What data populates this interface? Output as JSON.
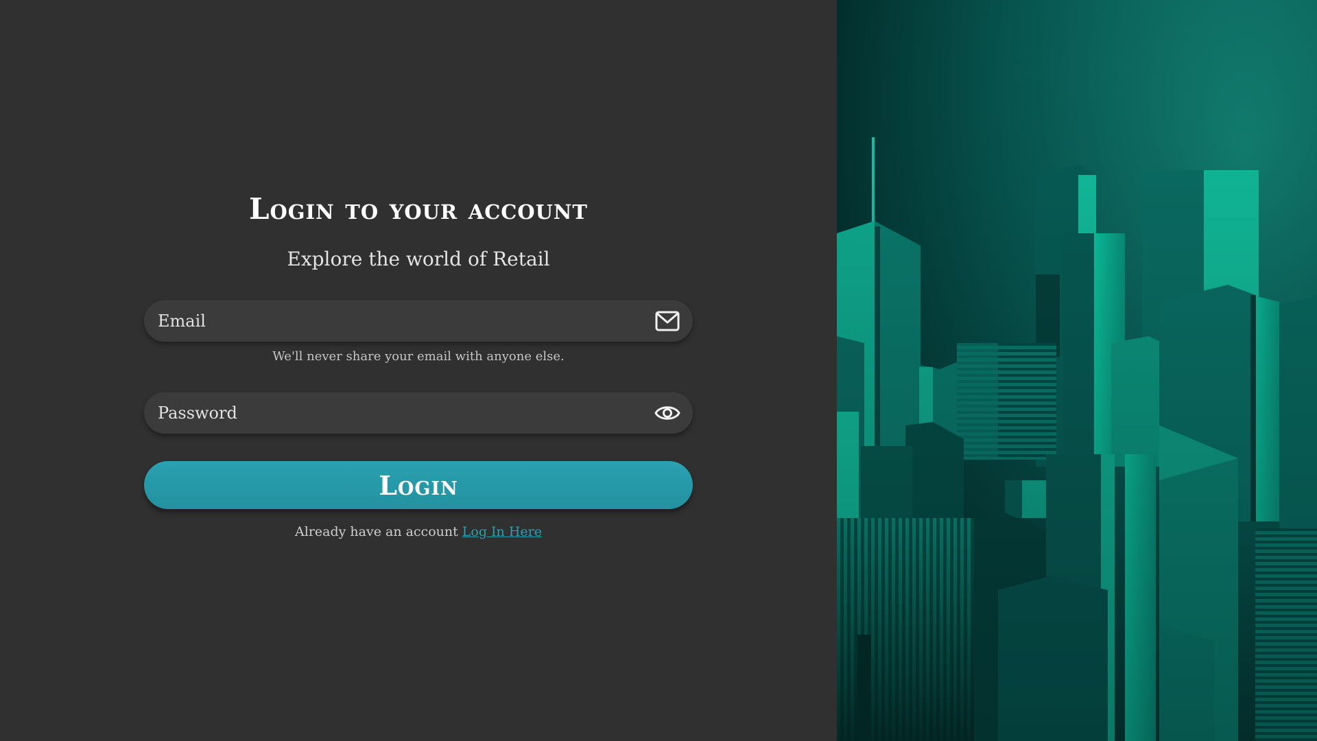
{
  "login": {
    "title": "Login to your account",
    "subtitle": "Explore the world of Retail",
    "email": {
      "placeholder": "Email",
      "value": "",
      "icon": "envelope-icon",
      "help_text": "We'll never share your email with anyone else."
    },
    "password": {
      "placeholder": "Password",
      "value": "",
      "icon": "eye-icon"
    },
    "button_label": "Login",
    "account_prompt": "Already have an account",
    "account_link": "Log In Here"
  },
  "theme": {
    "background": "#303030",
    "field_background": "#3b3b3b",
    "accent": "#2596a6",
    "text": "#ffffff"
  },
  "illustration": {
    "subject": "teal-cityscape-illustration"
  }
}
